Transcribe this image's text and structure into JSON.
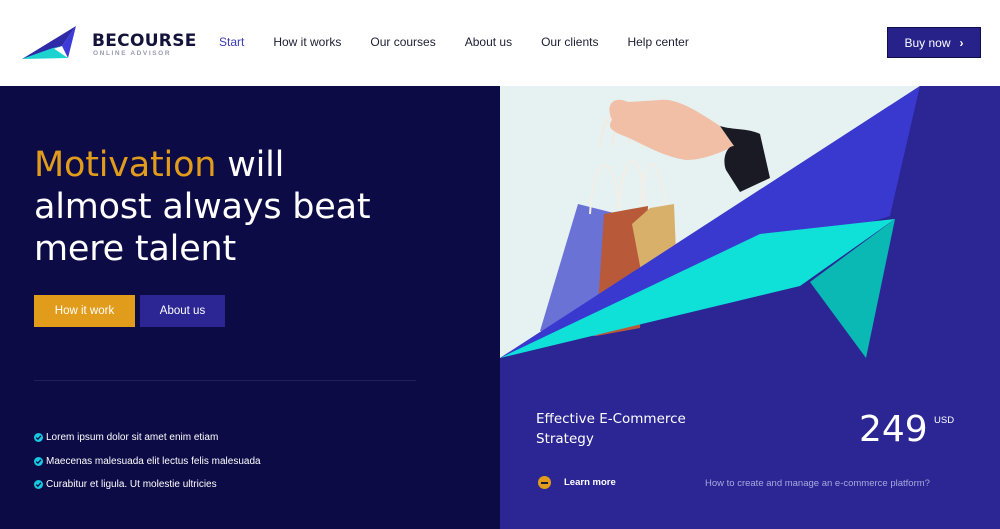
{
  "brand": {
    "name": "Becourse",
    "tagline": "ONLINE ADVISOR",
    "logo_icon": "paper-plane-icon"
  },
  "nav": {
    "items": [
      {
        "label": "Start",
        "active": true
      },
      {
        "label": "How it works",
        "active": false
      },
      {
        "label": "Our courses",
        "active": false
      },
      {
        "label": "About us",
        "active": false
      },
      {
        "label": "Our clients",
        "active": false
      },
      {
        "label": "Help center",
        "active": false
      }
    ],
    "cta_label": "Buy now",
    "cta_icon": "chevron-right-icon"
  },
  "hero": {
    "headline_highlight": "Motivation",
    "headline_rest_line1": " will",
    "headline_line2": "almost always beat",
    "headline_line3": "mere talent",
    "primary_button": "How it work",
    "secondary_button": "About us",
    "features": [
      "Lorem ipsum dolor sit amet enim etiam",
      "Maecenas malesuada elit lectus felis malesuada",
      "Curabitur et ligula. Ut molestie ultricies"
    ],
    "feature_icon": "check-circle-icon"
  },
  "offer": {
    "title_line1": "Effective E-Commerce",
    "title_line2": "Strategy",
    "price": "249",
    "currency": "USD",
    "link_label": "Learn more",
    "link_icon": "minus-circle-icon",
    "question": "How to create and manage an e-commerce platform?"
  },
  "colors": {
    "navy": "#0d0b46",
    "indigo": "#2b2693",
    "accent": "#e29c1b",
    "cyan": "#15c9e0",
    "button_dark": "#26228a"
  }
}
